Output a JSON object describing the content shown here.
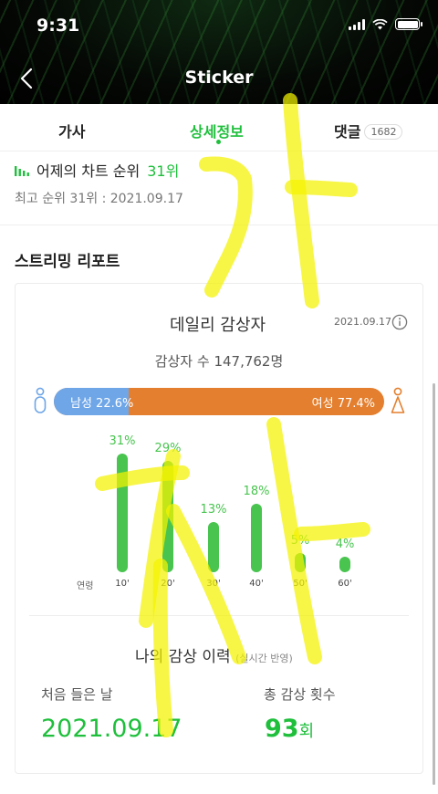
{
  "status_bar": {
    "time": "9:31"
  },
  "nav": {
    "title": "Sticker",
    "back_icon": "chevron-left-icon"
  },
  "tabs": [
    {
      "label": "가사",
      "active": false
    },
    {
      "label": "상세정보",
      "active": true
    },
    {
      "label": "댓글",
      "badge": "1682",
      "active": false
    }
  ],
  "chart_rank": {
    "icon": "bar-chart-icon",
    "label": "어제의 차트 순위",
    "value": "31위",
    "best": "최고 순위 31위 : 2021.09.17"
  },
  "report": {
    "title": "스트리밍 리포트",
    "daily_title": "데일리 감상자",
    "date": "2021.09.17",
    "listeners": "감상자 수 147,762명",
    "male": {
      "label": "남성 22.6%",
      "share": 22.6,
      "color": "#6ea6e8"
    },
    "female": {
      "label": "여성 77.4%",
      "share": 77.4,
      "color": "#e37f2e"
    },
    "age_axis_label": "연령",
    "age_groups": [
      {
        "label": "10'",
        "percent": "31%",
        "value": 31
      },
      {
        "label": "20'",
        "percent": "29%",
        "value": 29
      },
      {
        "label": "30'",
        "percent": "13%",
        "value": 13
      },
      {
        "label": "40'",
        "percent": "18%",
        "value": 18
      },
      {
        "label": "50'",
        "percent": "5%",
        "value": 5
      },
      {
        "label": "60'",
        "percent": "4%",
        "value": 4
      }
    ]
  },
  "history": {
    "title": "나의 감상 이력",
    "subtitle": "(실시간 반영)",
    "first_label": "처음 들은 날",
    "first_value": "2021.09.17",
    "count_label": "총 감상 횟수",
    "count_value": "93",
    "count_unit": "회"
  },
  "colors": {
    "accent": "#1fbf3c",
    "bar": "#48c44f",
    "highlighter": "#f4f200"
  },
  "overlay": {
    "handwriting": "가자"
  }
}
